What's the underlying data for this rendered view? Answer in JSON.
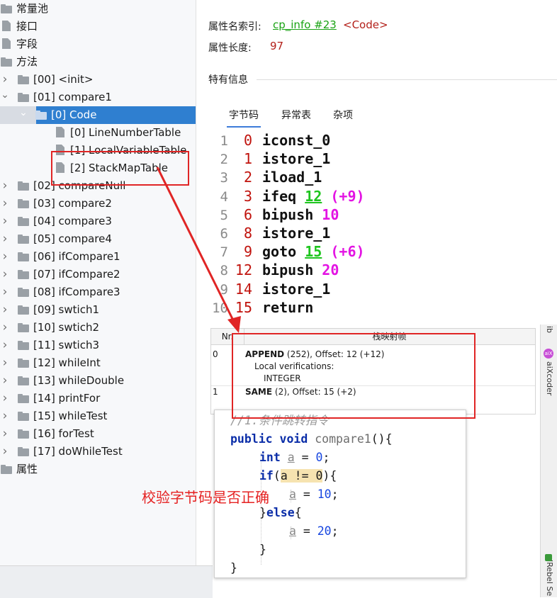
{
  "tree": {
    "items": [
      {
        "label": "常量池",
        "indent": 0,
        "expand": "",
        "icon": "folder"
      },
      {
        "label": "接口",
        "indent": 0,
        "expand": "",
        "icon": "file"
      },
      {
        "label": "字段",
        "indent": 0,
        "expand": "",
        "icon": "file"
      },
      {
        "label": "方法",
        "indent": 0,
        "expand": "",
        "icon": "folder"
      },
      {
        "label": "[00] <init>",
        "indent": 1,
        "expand": "collapsed",
        "icon": "folder"
      },
      {
        "label": "[01] compare1",
        "indent": 1,
        "expand": "expanded",
        "icon": "folder"
      },
      {
        "label": "[0] Code",
        "indent": 2,
        "expand": "expanded",
        "icon": "folder",
        "selected": true
      },
      {
        "label": "[0] LineNumberTable",
        "indent": 3,
        "expand": "",
        "icon": "file"
      },
      {
        "label": "[1] LocalVariableTable",
        "indent": 3,
        "expand": "",
        "icon": "file"
      },
      {
        "label": "[2] StackMapTable",
        "indent": 3,
        "expand": "",
        "icon": "file"
      },
      {
        "label": "[02] compareNull",
        "indent": 1,
        "expand": "collapsed",
        "icon": "folder"
      },
      {
        "label": "[03] compare2",
        "indent": 1,
        "expand": "collapsed",
        "icon": "folder"
      },
      {
        "label": "[04] compare3",
        "indent": 1,
        "expand": "collapsed",
        "icon": "folder"
      },
      {
        "label": "[05] compare4",
        "indent": 1,
        "expand": "collapsed",
        "icon": "folder"
      },
      {
        "label": "[06] ifCompare1",
        "indent": 1,
        "expand": "collapsed",
        "icon": "folder"
      },
      {
        "label": "[07] ifCompare2",
        "indent": 1,
        "expand": "collapsed",
        "icon": "folder"
      },
      {
        "label": "[08] ifCompare3",
        "indent": 1,
        "expand": "collapsed",
        "icon": "folder"
      },
      {
        "label": "[09] swtich1",
        "indent": 1,
        "expand": "collapsed",
        "icon": "folder"
      },
      {
        "label": "[10] swtich2",
        "indent": 1,
        "expand": "collapsed",
        "icon": "folder"
      },
      {
        "label": "[11] swtich3",
        "indent": 1,
        "expand": "collapsed",
        "icon": "folder"
      },
      {
        "label": "[12] whileInt",
        "indent": 1,
        "expand": "collapsed",
        "icon": "folder"
      },
      {
        "label": "[13] whileDouble",
        "indent": 1,
        "expand": "collapsed",
        "icon": "folder"
      },
      {
        "label": "[14] printFor",
        "indent": 1,
        "expand": "collapsed",
        "icon": "folder"
      },
      {
        "label": "[15] whileTest",
        "indent": 1,
        "expand": "collapsed",
        "icon": "folder"
      },
      {
        "label": "[16] forTest",
        "indent": 1,
        "expand": "collapsed",
        "icon": "folder"
      },
      {
        "label": "[17] doWhileTest",
        "indent": 1,
        "expand": "collapsed",
        "icon": "folder"
      },
      {
        "label": "属性",
        "indent": 0,
        "expand": "",
        "icon": "folder"
      }
    ]
  },
  "info": {
    "name_index_label": "属性名索引:",
    "name_index_link": "cp_info #23",
    "name_index_value": "<Code>",
    "length_label": "属性长度:",
    "length_value": "97",
    "section_title": "特有信息"
  },
  "tabs": [
    "字节码",
    "异常表",
    "杂项"
  ],
  "bytecode": [
    {
      "line": "1",
      "offset": "0",
      "op": "iconst_0",
      "arg": "",
      "arg_type": "",
      "rel": ""
    },
    {
      "line": "2",
      "offset": "1",
      "op": "istore_1",
      "arg": "",
      "arg_type": "",
      "rel": ""
    },
    {
      "line": "3",
      "offset": "2",
      "op": "iload_1",
      "arg": "",
      "arg_type": "",
      "rel": ""
    },
    {
      "line": "4",
      "offset": "3",
      "op": "ifeq",
      "arg": "12",
      "arg_type": "jump",
      "rel": "(+9)"
    },
    {
      "line": "5",
      "offset": "6",
      "op": "bipush",
      "arg": "10",
      "arg_type": "num",
      "rel": ""
    },
    {
      "line": "6",
      "offset": "8",
      "op": "istore_1",
      "arg": "",
      "arg_type": "",
      "rel": ""
    },
    {
      "line": "7",
      "offset": "9",
      "op": "goto",
      "arg": "15",
      "arg_type": "jump",
      "rel": "(+6)"
    },
    {
      "line": "8",
      "offset": "12",
      "op": "bipush",
      "arg": "20",
      "arg_type": "num",
      "rel": ""
    },
    {
      "line": "9",
      "offset": "14",
      "op": "istore_1",
      "arg": "",
      "arg_type": "",
      "rel": ""
    },
    {
      "line": "10",
      "offset": "15",
      "op": "return",
      "arg": "",
      "arg_type": "",
      "rel": ""
    }
  ],
  "stack_map": {
    "col_nr": "Nr.",
    "col_frame": "栈映射帧",
    "row0_nr": "0",
    "row0_kind": "APPEND",
    "row0_rest": " (252), Offset: 12 (+12)",
    "row0_sub1": "Local verifications:",
    "row0_sub2": "INTEGER",
    "row1_nr": "1",
    "row1_kind": "SAME",
    "row1_rest": " (2), Offset: 15 (+2)"
  },
  "source": {
    "comment": "//1.条件跳转指令",
    "kw_public": "public",
    "kw_void": "void",
    "method": "compare1",
    "sig_rest": "(){",
    "kw_int": "int",
    "var_a": "a",
    "eq_zero": " = ",
    "n0": "0",
    "semi": ";",
    "kw_if": "if",
    "cond_open": "(",
    "cond": "a != 0",
    "cond_close": "){",
    "n10": "10",
    "close_else_pre": "}",
    "kw_else": "else",
    "brace_open": "{",
    "n20": "20",
    "close1": "}",
    "close2": "}"
  },
  "side_strip": {
    "top": "ib",
    "aixcoder": "aiXcoder",
    "jrebel": "JRebel Se"
  },
  "annotation": "校验字节码是否正确",
  "colors": {
    "annotation": "#e52222",
    "selection": "#2f7fd0",
    "jump": "#1ec51e",
    "number": "#e313e3",
    "offset": "#c0120c"
  }
}
